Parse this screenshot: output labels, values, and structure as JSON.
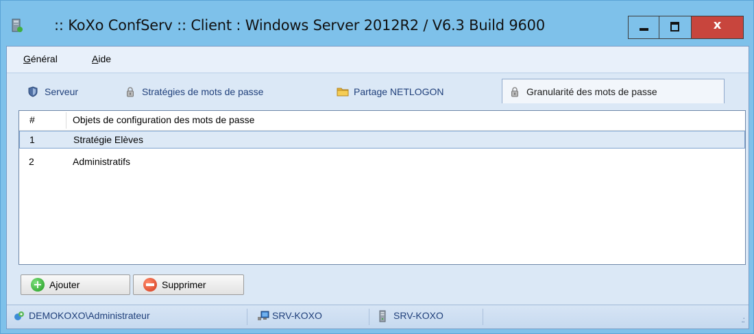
{
  "window": {
    "title": ":: KoXo ConfServ :: Client : Windows Server 2012R2 / V6.3 Build 9600",
    "close_label": "x"
  },
  "menu": {
    "items": [
      {
        "accel": "G",
        "rest": "énéral"
      },
      {
        "accel": "A",
        "rest": "ide"
      }
    ]
  },
  "tabs": [
    {
      "label": "Serveur",
      "icon": "shield-icon"
    },
    {
      "label": "Stratégies de mots de passe",
      "icon": "lock-icon"
    },
    {
      "label": "Partage NETLOGON",
      "icon": "folder-icon"
    },
    {
      "label": "Granularité des mots de passe",
      "icon": "lock-icon",
      "active": true
    }
  ],
  "list": {
    "headers": {
      "num": "#",
      "objects": "Objets de configuration des mots de passe"
    },
    "rows": [
      {
        "num": "1",
        "name": "Stratégie Elèves",
        "selected": true
      },
      {
        "num": "2",
        "name": "Administratifs",
        "selected": false
      }
    ]
  },
  "buttons": {
    "add_label": "Ajouter",
    "delete_label": "Supprimer"
  },
  "status": {
    "user": "DEMOKOXO\\Administrateur",
    "server": "SRV-KOXO",
    "host": "SRV-KOXO"
  },
  "colors": {
    "frame": "#7ec1ea",
    "close": "#c8453d",
    "selection": "#dde9f6"
  }
}
